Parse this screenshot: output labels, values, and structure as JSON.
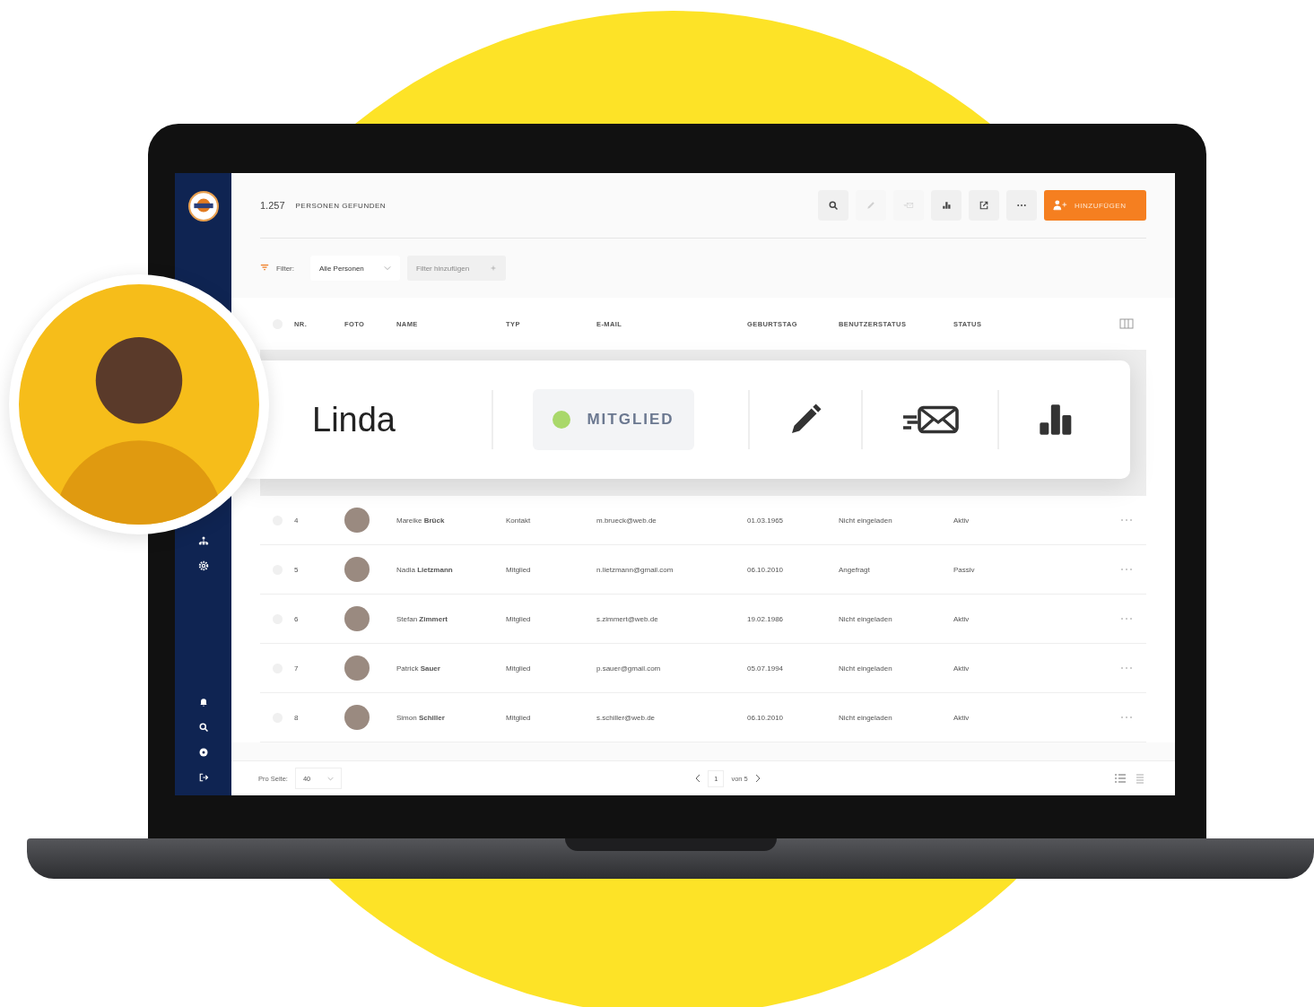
{
  "header": {
    "count": "1.257",
    "label": "PERSONEN GEFUNDEN",
    "add_button": "HINZUFÜGEN"
  },
  "toolbar": [
    {
      "kind": "search",
      "disabled": false
    },
    {
      "kind": "edit",
      "disabled": true
    },
    {
      "kind": "mail",
      "disabled": true
    },
    {
      "kind": "chart",
      "disabled": false
    },
    {
      "kind": "export",
      "disabled": false
    },
    {
      "kind": "more",
      "disabled": false
    }
  ],
  "filter": {
    "label": "Filter:",
    "select": "Alle Personen",
    "add": "Filter hinzufügen"
  },
  "table": {
    "select_all_checked": false,
    "columns": [
      "NR.",
      "FOTO",
      "NAME",
      "TYP",
      "E-MAIL",
      "GEBURTSTAG",
      "BENUTZERSTATUS",
      "STATUS"
    ],
    "rows": [
      {
        "checked": false,
        "nr": "4",
        "name": "Mareike **Brück**",
        "type": "Kontakt",
        "email": "m.brueck@web.de",
        "birthday": "01.03.1965",
        "user_status": "Nicht eingeladen",
        "status": "Aktiv"
      },
      {
        "checked": false,
        "nr": "5",
        "name": "Nadia **Lietzmann**",
        "type": "Mitglied",
        "email": "n.lietzmann@gmail.com",
        "birthday": "06.10.2010",
        "user_status": "Angefragt",
        "status": "Passiv"
      },
      {
        "checked": false,
        "nr": "6",
        "name": "Stefan **Zimmert**",
        "type": "Mitglied",
        "email": "s.zimmert@web.de",
        "birthday": "19.02.1986",
        "user_status": "Nicht eingeladen",
        "status": "Aktiv"
      },
      {
        "checked": false,
        "nr": "7",
        "name": "Patrick **Sauer**",
        "type": "Mitglied",
        "email": "p.sauer@gmail.com",
        "birthday": "05.07.1994",
        "user_status": "Nicht eingeladen",
        "status": "Aktiv"
      },
      {
        "checked": false,
        "nr": "8",
        "name": "Simon **Schiller**",
        "type": "Mitglied",
        "email": "s.schiller@web.de",
        "birthday": "06.10.2010",
        "user_status": "Nicht eingeladen",
        "status": "Aktiv"
      }
    ]
  },
  "footer": {
    "per_page_label": "Pro Seite:",
    "per_page": "40",
    "page": "1",
    "of": "von 5"
  },
  "card": {
    "name": "Linda",
    "badge": "MITGLIED"
  }
}
